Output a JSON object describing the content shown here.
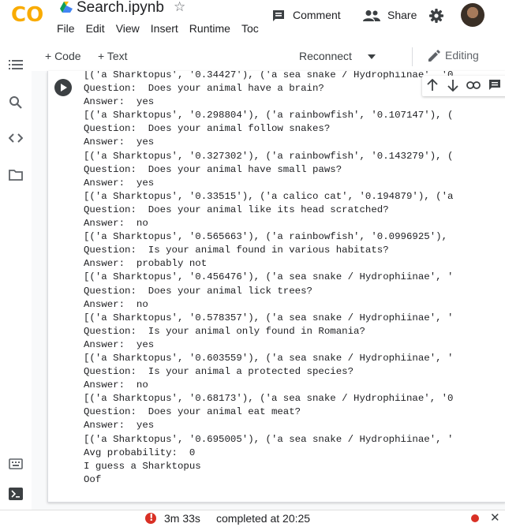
{
  "app": {
    "logo_text": "CO",
    "notebook_title": "Search.ipynb",
    "menu": [
      "File",
      "Edit",
      "View",
      "Insert",
      "Runtime",
      "Toc"
    ],
    "comment_label": "Comment",
    "share_label": "Share"
  },
  "toolbar": {
    "add_code_label": "+ Code",
    "add_text_label": "+ Text",
    "connect_label": "Reconnect",
    "mode_label": "Editing"
  },
  "output_lines": [
    "[('a Sharktopus', '0.34427'), ('a sea snake / Hydrophiinae', '0",
    "Question:  Does your animal have a brain?",
    "Answer:  yes",
    "[('a Sharktopus', '0.298804'), ('a rainbowfish', '0.107147'), (",
    "Question:  Does your animal follow snakes?",
    "Answer:  yes",
    "[('a Sharktopus', '0.327302'), ('a rainbowfish', '0.143279'), (",
    "Question:  Does your animal have small paws?",
    "Answer:  yes",
    "[('a Sharktopus', '0.33515'), ('a calico cat', '0.194879'), ('a",
    "Question:  Does your animal like its head scratched?",
    "Answer:  no",
    "[('a Sharktopus', '0.565663'), ('a rainbowfish', '0.0996925'),",
    "Question:  Is your animal found in various habitats?",
    "Answer:  probably not",
    "[('a Sharktopus', '0.456476'), ('a sea snake / Hydrophiinae', '",
    "Question:  Does your animal lick trees?",
    "Answer:  no",
    "[('a Sharktopus', '0.578357'), ('a sea snake / Hydrophiinae', '",
    "Question:  Is your animal only found in Romania?",
    "Answer:  yes",
    "[('a Sharktopus', '0.603559'), ('a sea snake / Hydrophiinae', '",
    "Question:  Is your animal a protected species?",
    "Answer:  no",
    "[('a Sharktopus', '0.68173'), ('a sea snake / Hydrophiinae', '0",
    "Question:  Does your animal eat meat?",
    "Answer:  yes",
    "[('a Sharktopus', '0.695005'), ('a sea snake / Hydrophiinae', '",
    "Avg probability:  0",
    "I guess a Sharktopus",
    "Oof"
  ],
  "status": {
    "elapsed": "3m 33s",
    "completed": "completed at 20:25"
  },
  "colors": {
    "logo": "#f9ab00",
    "error": "#d93025"
  },
  "icons": {
    "sidebar": [
      "toc-icon",
      "search-icon",
      "code-snippets-icon",
      "files-icon"
    ],
    "sidebar_bottom": [
      "command-palette-icon",
      "terminal-icon"
    ],
    "cell_toolbar": [
      "move-up-icon",
      "move-down-icon",
      "link-icon",
      "comment-icon",
      "settings-icon"
    ]
  }
}
